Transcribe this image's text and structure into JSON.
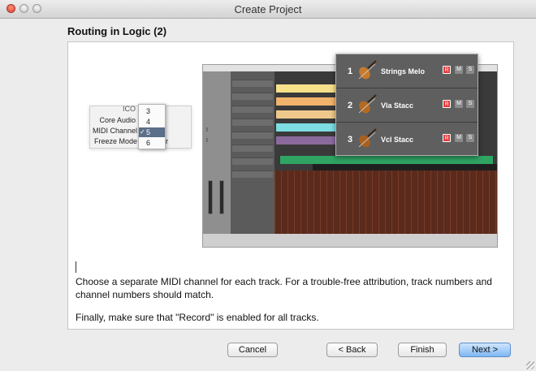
{
  "window": {
    "title": "Create Project"
  },
  "page": {
    "heading": "Routing in Logic (2)"
  },
  "zoom_tracks": [
    {
      "number": "1",
      "name": "Strings Melo",
      "r": "R",
      "m": "M",
      "s": "S"
    },
    {
      "number": "2",
      "name": "Vla Stacc",
      "r": "R",
      "m": "M",
      "s": "S"
    },
    {
      "number": "3",
      "name": "Vcl Stacc",
      "r": "R",
      "m": "M",
      "s": "S"
    }
  ],
  "popup": {
    "labels": [
      "ICO",
      "Core Audio",
      "MIDI Channel",
      "Freeze Mode"
    ],
    "freeze_suffix": "r",
    "menu_items": [
      "3",
      "4",
      "5",
      "6"
    ],
    "selected_index": 2,
    "check_glyph": "✓",
    "arrows": "⇕"
  },
  "body_text": {
    "para1": "Choose a separate MIDI channel for each track. For a trouble-free attribution, track numbers and channel numbers should match.",
    "para2": "Finally, make sure that \"Record\" is enabled for all tracks."
  },
  "buttons": {
    "cancel": "Cancel",
    "back": "< Back",
    "finish": "Finish",
    "next": "Next >"
  },
  "colors": {
    "record_red": "#e83a3a",
    "accent_blue": "#7fb7f2"
  }
}
